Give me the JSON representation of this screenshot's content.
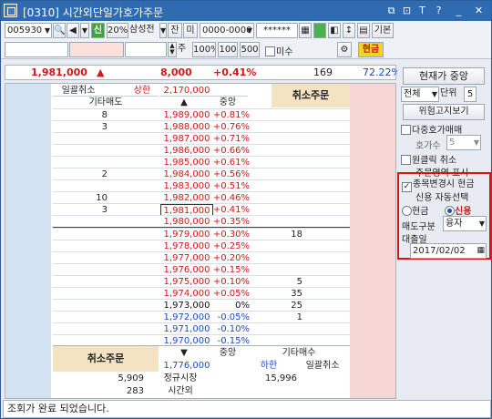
{
  "title": "[0310] 시간외단일가호가주문",
  "titlebar_icons": [
    "window-icon",
    "copy-icon",
    "link-icon",
    "font-size-icon",
    "help-icon",
    "minimize-icon",
    "close-icon"
  ],
  "toolbar": {
    "code": "005930",
    "sin": "신",
    "pct": "20%",
    "stock_name": "삼성전",
    "jan": "잔",
    "mi": "미",
    "account": "0000-0000",
    "password": "******",
    "basic": "기본",
    "ju": "주",
    "q100pct": "100%",
    "q100": "100",
    "q500": "500",
    "misu": "미수",
    "cash": "현금"
  },
  "summary": {
    "price": "1,981,000",
    "arrow": "▲",
    "change": "8,000",
    "rate": "+0.41%",
    "volume": "169",
    "ratio": "72.22%"
  },
  "header": {
    "bulk_cancel": "일괄취소",
    "upper_label": "상한",
    "upper_price": "2,170,000",
    "other_sell": "기타매도",
    "up_arrow": "▲",
    "mid": "중앙",
    "cancel_order": "취소주문"
  },
  "asks": [
    {
      "qty": "8",
      "price": "1,989,000",
      "rate": "+0.81%",
      "bid": ""
    },
    {
      "qty": "3",
      "price": "1,988,000",
      "rate": "+0.76%",
      "bid": ""
    },
    {
      "qty": "",
      "price": "1,987,000",
      "rate": "+0.71%",
      "bid": ""
    },
    {
      "qty": "",
      "price": "1,986,000",
      "rate": "+0.66%",
      "bid": ""
    },
    {
      "qty": "",
      "price": "1,985,000",
      "rate": "+0.61%",
      "bid": ""
    },
    {
      "qty": "2",
      "price": "1,984,000",
      "rate": "+0.56%",
      "bid": ""
    },
    {
      "qty": "",
      "price": "1,983,000",
      "rate": "+0.51%",
      "bid": ""
    },
    {
      "qty": "10",
      "price": "1,982,000",
      "rate": "+0.46%",
      "bid": ""
    },
    {
      "qty": "3",
      "price": "1,981,000",
      "rate": "+0.41%",
      "bid": ""
    },
    {
      "qty": "",
      "price": "1,980,000",
      "rate": "+0.35%",
      "bid": ""
    }
  ],
  "bids": [
    {
      "price": "1,979,000",
      "rate": "+0.30%",
      "qty": "18",
      "color": "#d01818"
    },
    {
      "price": "1,978,000",
      "rate": "+0.25%",
      "qty": "",
      "color": "#d01818"
    },
    {
      "price": "1,977,000",
      "rate": "+0.20%",
      "qty": "",
      "color": "#d01818"
    },
    {
      "price": "1,976,000",
      "rate": "+0.15%",
      "qty": "",
      "color": "#d01818"
    },
    {
      "price": "1,975,000",
      "rate": "+0.10%",
      "qty": "5",
      "color": "#d01818"
    },
    {
      "price": "1,974,000",
      "rate": "+0.05%",
      "qty": "35",
      "color": "#d01818"
    },
    {
      "price": "1,973,000",
      "rate": "0%",
      "qty": "25",
      "color": "#111111"
    },
    {
      "price": "1,972,000",
      "rate": "-0.05%",
      "qty": "1",
      "color": "#1a4cc0"
    },
    {
      "price": "1,971,000",
      "rate": "-0.10%",
      "qty": "",
      "color": "#1a4cc0"
    },
    {
      "price": "1,970,000",
      "rate": "-0.15%",
      "qty": "",
      "color": "#1a4cc0"
    }
  ],
  "footer": {
    "cancel_order": "취소주문",
    "down_arrow": "▼",
    "mid": "중앙",
    "other_buy": "기타매수",
    "lower_price": "1,776,000",
    "lower_label": "하한",
    "bulk_cancel": "일괄취소",
    "regular_qty": "5,909",
    "regular_label": "정규시장",
    "regular_buy": "15,996",
    "after_qty": "283",
    "after_label": "시간외"
  },
  "right_panel": {
    "current_center": "현재가 중앙",
    "all": "전체",
    "unit_label": "단위",
    "unit": "5",
    "fix_window": "위험고지보기",
    "multi_order": "다중호가매매",
    "hoga_label": "호가수",
    "hoga_value": "5",
    "one_click": "원클릭 취소",
    "order_area": "주문영역 표시",
    "stock_change": "종목변경시 현금",
    "credit_auto": "신용 자동선택",
    "cash": "현금",
    "credit": "신용",
    "sell_type_label": "매도구분",
    "sell_type": "융자",
    "loan_date_label": "대출일",
    "loan_date": "2017/02/02"
  },
  "status": "조회가 완료 되었습니다.",
  "colors": {
    "up": "#d01818",
    "down": "#1a4cc0",
    "ask_bg": "#d3e3f3",
    "bid_bg": "#f7d6d6",
    "highlight_border": "#e01010"
  }
}
